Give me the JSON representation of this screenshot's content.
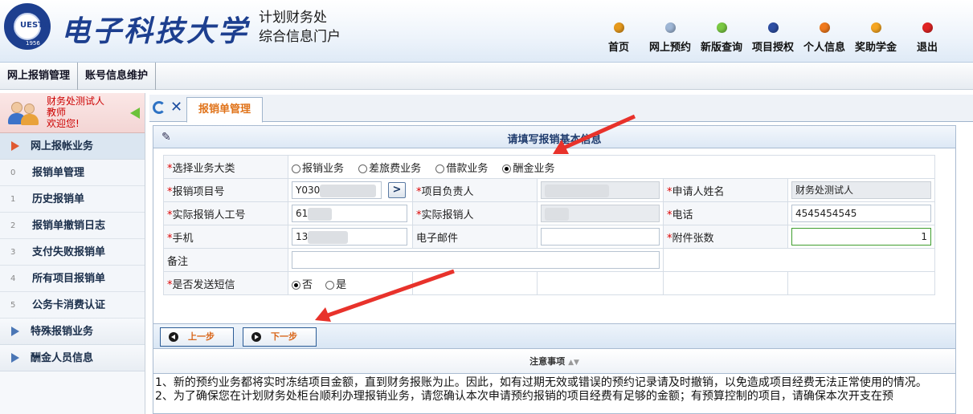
{
  "header": {
    "university_name": "电子科技大学",
    "logo_text": "UESTC",
    "logo_year": "1956",
    "portal_title_line1": "计划财务处",
    "portal_title_line2": "综合信息门户",
    "nav": [
      {
        "label": "首页",
        "color": "#e69a1e"
      },
      {
        "label": "网上预约",
        "color": "#9fb7d6"
      },
      {
        "label": "新版查询",
        "color": "#7ac943"
      },
      {
        "label": "项目授权",
        "color": "#2e4fa3"
      },
      {
        "label": "个人信息",
        "color": "#f07a1e"
      },
      {
        "label": "奖助学金",
        "color": "#f5a623"
      },
      {
        "label": "退出",
        "color": "#e02424"
      }
    ]
  },
  "menubar": {
    "items": [
      "网上报销管理",
      "账号信息维护"
    ]
  },
  "sidebar": {
    "user": {
      "name": "财务处测试人",
      "role": "教师",
      "greeting": "欢迎您!"
    },
    "group_main": "网上报帐业务",
    "items": [
      {
        "num": "0",
        "label": "报销单管理"
      },
      {
        "num": "1",
        "label": "历史报销单"
      },
      {
        "num": "2",
        "label": "报销单撤销日志"
      },
      {
        "num": "3",
        "label": "支付失败报销单"
      },
      {
        "num": "4",
        "label": "所有项目报销单"
      },
      {
        "num": "5",
        "label": "公务卡消费认证"
      }
    ],
    "group_special": "特殊报销业务",
    "group_staff": "酬金人员信息"
  },
  "tab": {
    "label": "报销单管理"
  },
  "panel": {
    "title": "请填写报销基本信息"
  },
  "form": {
    "req_mark": "*",
    "category_label": "选择业务大类",
    "category_options": [
      "报销业务",
      "差旅费业务",
      "借款业务",
      "酬金业务"
    ],
    "category_selected": 3,
    "project_no_label": "报销项目号",
    "project_no_value": "Y030",
    "project_lead_label": "项目负责人",
    "applicant_name_label": "申请人姓名",
    "applicant_name_value": "财务处测试人",
    "actual_id_label": "实际报销人工号",
    "actual_id_value": "61",
    "actual_person_label": "实际报销人",
    "phone_label": "电话",
    "phone_value": "4545454545",
    "mobile_label": "手机",
    "mobile_value": "13",
    "email_label": "电子邮件",
    "attach_label": "附件张数",
    "attach_value": "1",
    "remark_label": "备注",
    "sms_label": "是否发送短信",
    "sms_options": [
      "否",
      "是"
    ],
    "sms_selected": 0,
    "go_symbol": ">"
  },
  "buttons": {
    "prev": "上一步",
    "next": "下一步"
  },
  "notice": {
    "title": "注意事项",
    "line1": "1、新的预约业务都将实时冻结项目金额，直到财务报账为止。因此，如有过期无效或错误的预约记录请及时撤销，以免造成项目经费无法正常使用的情况。",
    "line2": "2、为了确保您在计划财务处柜台顺利办理报销业务，请您确认本次申请预约报销的项目经费有足够的金额；有预算控制的项目，请确保本次开支在预"
  },
  "annotation_color": "#e8322b"
}
